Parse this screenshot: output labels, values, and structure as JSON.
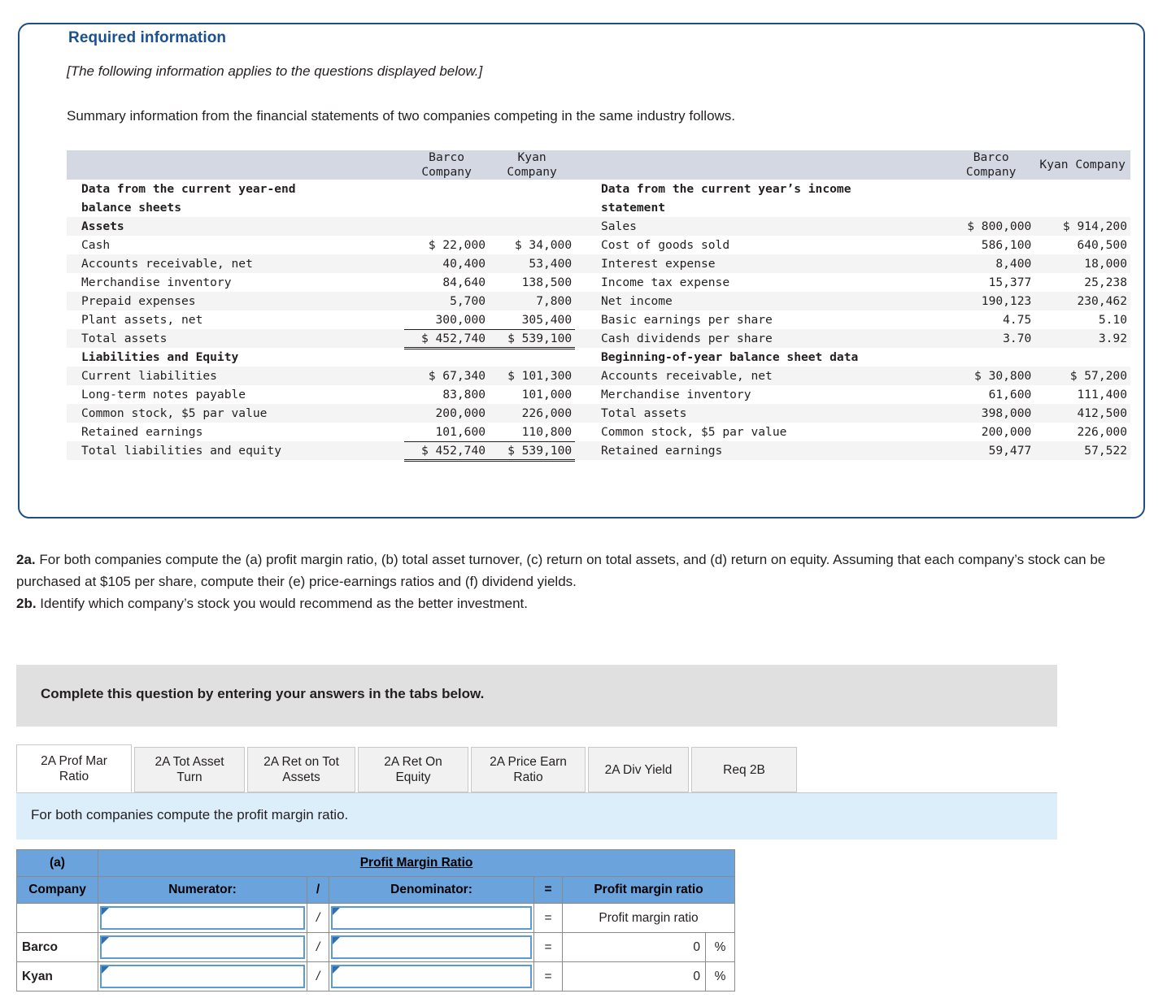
{
  "required_info": {
    "title": "Required information",
    "italic_note": "[The following information applies to the questions displayed below.]",
    "summary": "Summary information from the financial statements of two companies competing in the same industry follows."
  },
  "financial_table": {
    "headers": {
      "left_blank": "",
      "barco_left": "Barco\nCompany",
      "kyan_left": "Kyan\nCompany",
      "right_blank": "",
      "barco_right": "Barco\nCompany",
      "kyan_right": "Kyan Company"
    },
    "header_labels": {
      "barco_line1": "Barco",
      "barco_line2": "Company",
      "kyan_line1": "Kyan",
      "kyan_line2": "Company",
      "kyan_right_single": "Kyan Company"
    },
    "left_rows": [
      {
        "label": "Data from the current year-end",
        "barco": "",
        "kyan": "",
        "bold": true
      },
      {
        "label": "balance sheets",
        "barco": "",
        "kyan": "",
        "bold": true
      },
      {
        "label": "Assets",
        "barco": "",
        "kyan": "",
        "bold": true
      },
      {
        "label": "Cash",
        "barco": "$ 22,000",
        "kyan": "$ 34,000"
      },
      {
        "label": "Accounts receivable, net",
        "barco": "40,400",
        "kyan": "53,400"
      },
      {
        "label": "Merchandise inventory",
        "barco": "84,640",
        "kyan": "138,500"
      },
      {
        "label": "Prepaid expenses",
        "barco": "5,700",
        "kyan": "7,800"
      },
      {
        "label": "Plant assets, net",
        "barco": "300,000",
        "kyan": "305,400"
      },
      {
        "label": "Total assets",
        "barco": "$ 452,740",
        "kyan": "$ 539,100"
      },
      {
        "label": "Liabilities and Equity",
        "barco": "",
        "kyan": "",
        "bold": true
      },
      {
        "label": "Current liabilities",
        "barco": "$ 67,340",
        "kyan": "$ 101,300"
      },
      {
        "label": "Long-term notes payable",
        "barco": "83,800",
        "kyan": "101,000"
      },
      {
        "label": "Common stock, $5 par value",
        "barco": "200,000",
        "kyan": "226,000"
      },
      {
        "label": "Retained earnings",
        "barco": "101,600",
        "kyan": "110,800"
      },
      {
        "label": "Total liabilities and equity",
        "barco": "$ 452,740",
        "kyan": "$ 539,100"
      }
    ],
    "right_rows": [
      {
        "label": "Data from the current year’s income",
        "barco": "",
        "kyan": "",
        "bold": true
      },
      {
        "label": "statement",
        "barco": "",
        "kyan": "",
        "bold": true
      },
      {
        "label": "Sales",
        "barco": "$ 800,000",
        "kyan": "$ 914,200"
      },
      {
        "label": "Cost of goods sold",
        "barco": "586,100",
        "kyan": "640,500"
      },
      {
        "label": "Interest expense",
        "barco": "8,400",
        "kyan": "18,000"
      },
      {
        "label": "Income tax expense",
        "barco": "15,377",
        "kyan": "25,238"
      },
      {
        "label": "Net income",
        "barco": "190,123",
        "kyan": "230,462"
      },
      {
        "label": "Basic earnings per share",
        "barco": "4.75",
        "kyan": "5.10"
      },
      {
        "label": "Cash dividends per share",
        "barco": "3.70",
        "kyan": "3.92"
      },
      {
        "label": "Beginning-of-year balance sheet data",
        "barco": "",
        "kyan": "",
        "bold": true
      },
      {
        "label": "Accounts receivable, net",
        "barco": "$ 30,800",
        "kyan": "$ 57,200"
      },
      {
        "label": "Merchandise inventory",
        "barco": "61,600",
        "kyan": "111,400"
      },
      {
        "label": "Total assets",
        "barco": "398,000",
        "kyan": "412,500"
      },
      {
        "label": "Common stock, $5 par value",
        "barco": "200,000",
        "kyan": "226,000"
      },
      {
        "label": "Retained earnings",
        "barco": "59,477",
        "kyan": "57,522"
      }
    ]
  },
  "question": {
    "line1_label": "2a.",
    "line1_text": " For both companies compute the (a) profit margin ratio, (b) total asset turnover, (c) return on total assets, and (d) return on equity. Assuming that each company’s stock can be purchased at $105 per share, compute their (e) price-earnings ratios and (f) dividend yields.",
    "line2_label": "2b.",
    "line2_text": " Identify which company’s stock you would recommend as the better investment."
  },
  "complete_bar": {
    "text": "Complete this question by entering your answers in the tabs below."
  },
  "tabs": [
    {
      "label": "2A Prof Mar Ratio",
      "active": true
    },
    {
      "label": "2A Tot Asset Turn",
      "active": false
    },
    {
      "label": "2A Ret on Tot Assets",
      "active": false
    },
    {
      "label": "2A Ret On Equity",
      "active": false
    },
    {
      "label": "2A Price Earn Ratio",
      "active": false
    },
    {
      "label": "2A Div Yield",
      "active": false
    },
    {
      "label": "Req 2B",
      "active": false
    }
  ],
  "instruction": {
    "text": "For both companies compute the profit margin ratio."
  },
  "answer_table": {
    "part_label": "(a)",
    "title": "Profit Margin Ratio",
    "columns": {
      "company": "Company",
      "numerator": "Numerator:",
      "slash": "/",
      "denominator": "Denominator:",
      "equals": "=",
      "result": "Profit margin ratio"
    },
    "rows": [
      {
        "company": "",
        "numerator_value": "",
        "slash": "/",
        "denominator_value": "",
        "equals": "=",
        "result": "Profit margin ratio",
        "percent": "",
        "is_label_row": true
      },
      {
        "company": "Barco",
        "numerator_value": "",
        "slash": "/",
        "denominator_value": "",
        "equals": "=",
        "result": "0",
        "percent": "%",
        "is_label_row": false
      },
      {
        "company": "Kyan",
        "numerator_value": "",
        "slash": "/",
        "denominator_value": "",
        "equals": "=",
        "result": "0",
        "percent": "%",
        "is_label_row": false
      }
    ]
  },
  "colors": {
    "panel_border": "#1f4f82",
    "title_blue": "#1b5191",
    "table_header_bg": "#d3d8e3",
    "answer_header_bg": "#6ba3dd",
    "input_border": "#5b9bd5",
    "instruction_bg": "#ddeefb",
    "complete_bar_bg": "#e0e0e0"
  }
}
